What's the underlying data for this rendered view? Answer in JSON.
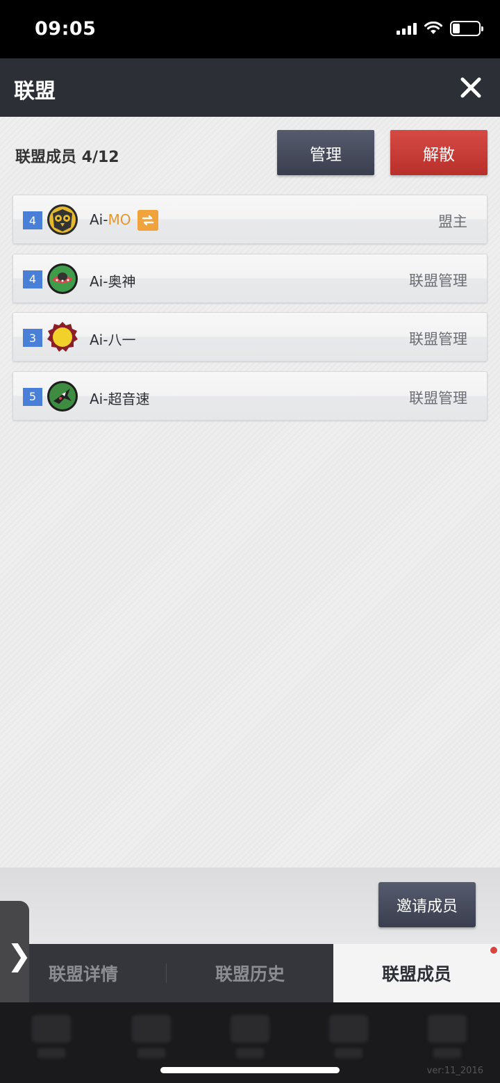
{
  "status_bar": {
    "time": "09:05"
  },
  "header": {
    "title": "联盟"
  },
  "members": {
    "count_label": "联盟成员 4/12",
    "manage_label": "管理",
    "dissolve_label": "解散",
    "items": [
      {
        "level": "4",
        "name_prefix": "Ai-",
        "name_highlight": "MO",
        "role": "盟主",
        "avatar": "owl-emblem-icon",
        "sync": true
      },
      {
        "level": "4",
        "name_prefix": "Ai-奥神",
        "name_highlight": "",
        "role": "联盟管理",
        "avatar": "ufo-emblem-icon",
        "sync": false
      },
      {
        "level": "3",
        "name_prefix": "Ai-八一",
        "name_highlight": "",
        "role": "联盟管理",
        "avatar": "sun-emblem-icon",
        "sync": false
      },
      {
        "level": "5",
        "name_prefix": "Ai-超音速",
        "name_highlight": "",
        "role": "联盟管理",
        "avatar": "jet-emblem-icon",
        "sync": false
      }
    ]
  },
  "invite_label": "邀请成员",
  "side_handle": "❯",
  "tabs": [
    {
      "label": "联盟详情",
      "active": false
    },
    {
      "label": "联盟历史",
      "active": false
    },
    {
      "label": "联盟成员",
      "active": true
    }
  ],
  "version": "ver:11_2016",
  "colors": {
    "accent_red": "#c73a34",
    "level_blue": "#4a7fd8",
    "highlight_orange": "#e8962a"
  }
}
